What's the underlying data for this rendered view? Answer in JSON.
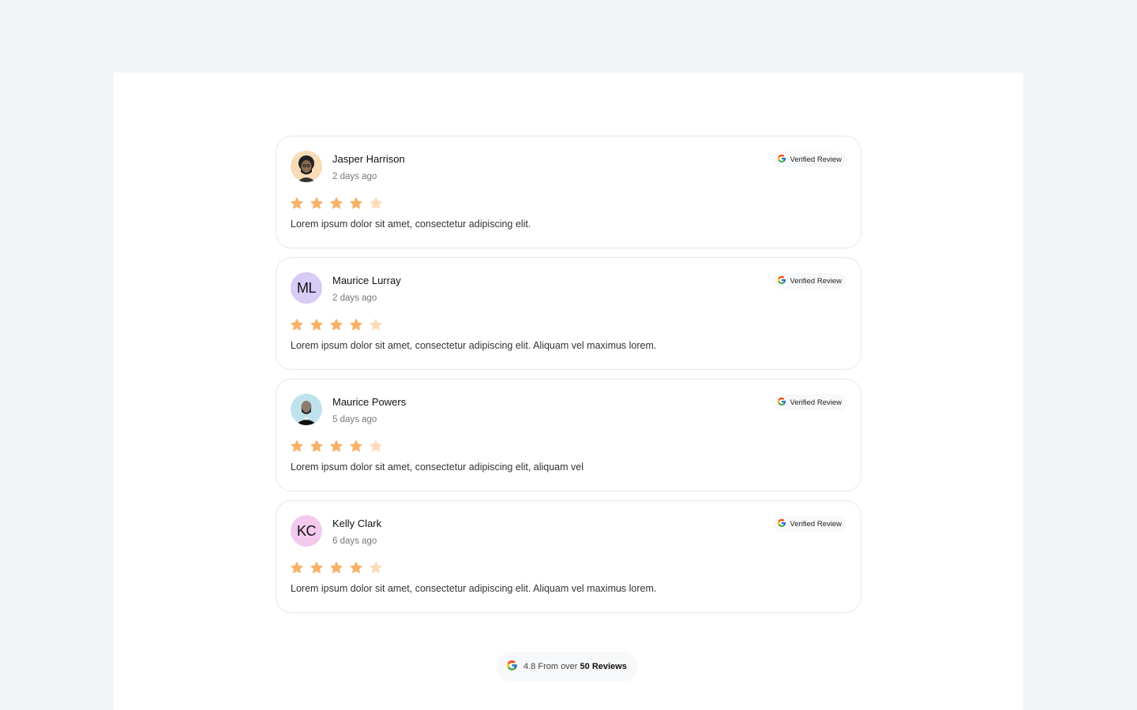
{
  "colors": {
    "page_bg": "#f1f5f8",
    "star_filled": "#f7b267",
    "star_empty": "#fcdcb8",
    "avatar_ml": "#d8cbf6",
    "avatar_kc": "#f3c9ee"
  },
  "badge_icon": "google-g-icon",
  "reviews": [
    {
      "name": "Jasper Harrison",
      "time": "2 days ago",
      "avatar_type": "photo",
      "rating": 4,
      "max_rating": 5,
      "badge_label": "Verified Review",
      "text": "Lorem ipsum dolor sit amet, consectetur adipiscing elit."
    },
    {
      "name": "Maurice Lurray",
      "time": "2 days ago",
      "avatar_type": "initials",
      "initials": "ML",
      "rating": 4,
      "max_rating": 5,
      "badge_label": "Verified Review",
      "text": "Lorem ipsum dolor sit amet, consectetur adipiscing elit. Aliquam vel maximus lorem."
    },
    {
      "name": "Maurice Powers",
      "time": "5 days ago",
      "avatar_type": "photo",
      "rating": 4,
      "max_rating": 5,
      "badge_label": "Verified Review",
      "text": "Lorem ipsum dolor sit amet, consectetur adipiscing elit, aliquam vel"
    },
    {
      "name": "Kelly Clark",
      "time": "6 days ago",
      "avatar_type": "initials",
      "initials": "KC",
      "rating": 4,
      "max_rating": 5,
      "badge_label": "Verified Review",
      "text": "Lorem ipsum dolor sit amet, consectetur adipiscing elit. Aliquam vel maximus lorem."
    }
  ],
  "summary": {
    "prefix": "4.8 From over",
    "emphasis": "50 Reviews"
  }
}
